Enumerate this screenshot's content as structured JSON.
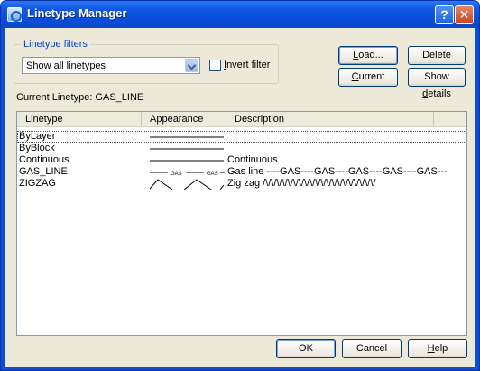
{
  "window": {
    "title": "Linetype Manager"
  },
  "filters": {
    "group_label": "Linetype filters",
    "selected": "Show all linetypes",
    "invert_label": "Invert filter",
    "invert_checked": false
  },
  "buttons": {
    "load": "Load...",
    "delete": "Delete",
    "current": "Current",
    "show_details": "Show details",
    "ok": "OK",
    "cancel": "Cancel",
    "help": "Help"
  },
  "current_linetype": "Current Linetype:  GAS_LINE",
  "table": {
    "columns": [
      "Linetype",
      "Appearance",
      "Description"
    ],
    "rows": [
      {
        "name": "ByLayer",
        "appearance": "solid",
        "description": ""
      },
      {
        "name": "ByBlock",
        "appearance": "solid",
        "description": ""
      },
      {
        "name": "Continuous",
        "appearance": "solid",
        "description": "Continuous"
      },
      {
        "name": "GAS_LINE",
        "appearance": "gas",
        "description": "Gas line ----GAS----GAS----GAS----GAS----GAS---"
      },
      {
        "name": "ZIGZAG",
        "appearance": "zigzag",
        "description": "Zig zag /\\/\\/\\/\\/\\/\\/\\/\\/\\/\\/\\/\\/\\/\\/\\/\\/\\/\\/\\/\\/"
      }
    ],
    "appearance_gas_text": "GAS"
  },
  "colors": {
    "titlebar": "#0a4fd6",
    "dialog_bg": "#ece9d8",
    "group_label": "#0046d5",
    "close_button": "#c9421f"
  }
}
